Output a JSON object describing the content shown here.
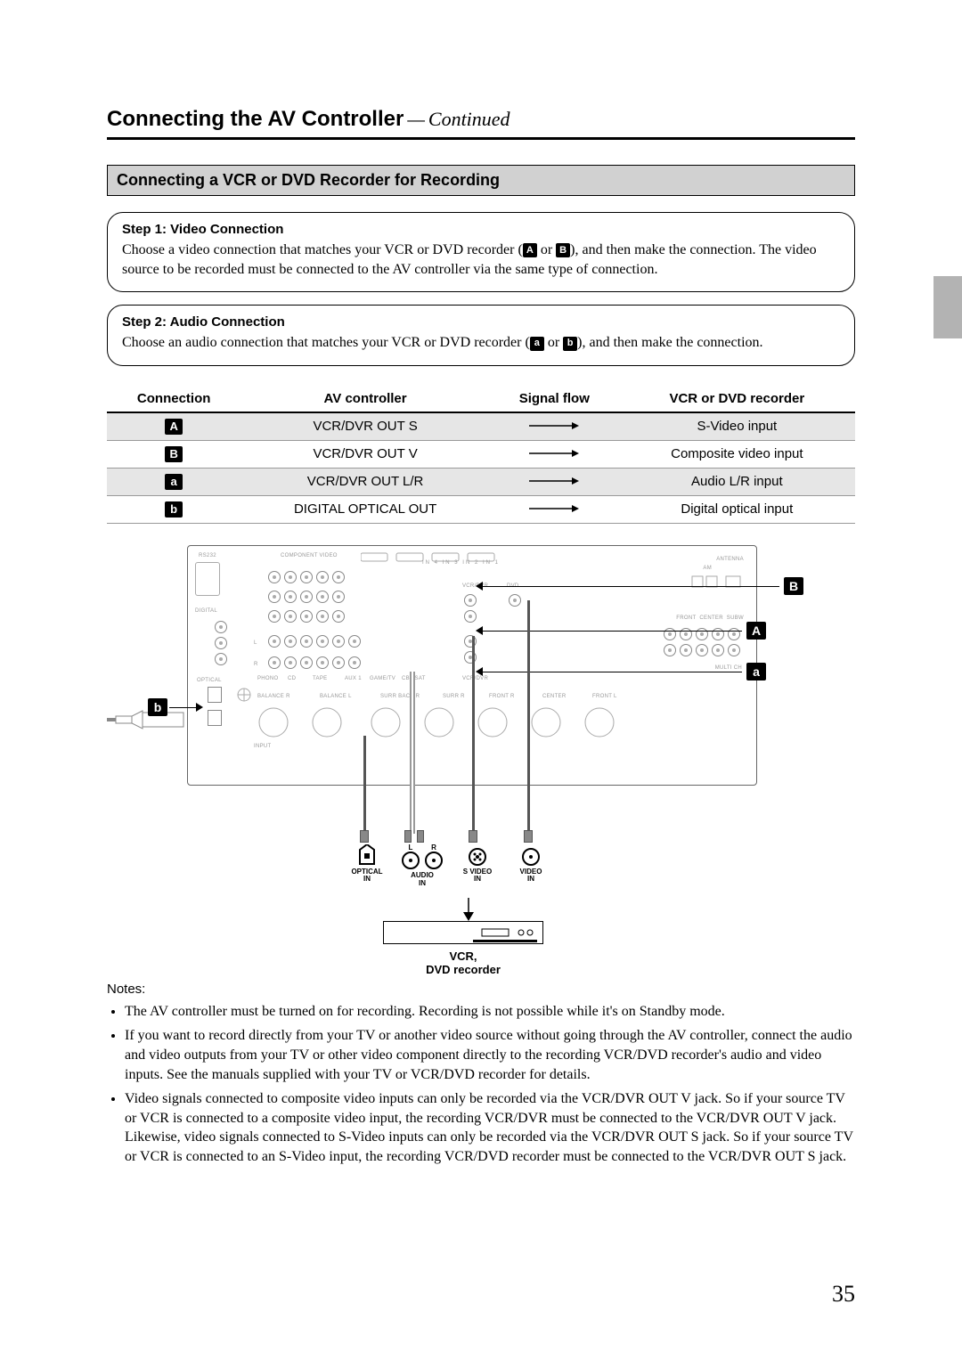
{
  "header": {
    "title_bold": "Connecting the AV Controller",
    "title_sep": "—",
    "title_italic": "Continued"
  },
  "section_bar": "Connecting a VCR or DVD Recorder for Recording",
  "step1": {
    "heading": "Step 1: Video Connection",
    "body_pre": "Choose a video connection that matches your VCR or DVD recorder (",
    "badge_a": "A",
    "mid": " or ",
    "badge_b": "B",
    "body_post": "), and then make the connection. The video source to be recorded must be connected to the AV controller via the same type of connection."
  },
  "step2": {
    "heading": "Step 2: Audio Connection",
    "body_pre": "Choose an audio connection that matches your VCR or DVD recorder (",
    "badge_a": "a",
    "mid": " or ",
    "badge_b": "b",
    "body_post": "), and then make the connection."
  },
  "table": {
    "headers": [
      "Connection",
      "AV controller",
      "Signal flow",
      "VCR or DVD recorder"
    ],
    "rows": [
      {
        "badge": "A",
        "avc": "VCR/DVR OUT S",
        "rec": "S-Video input",
        "shade": true
      },
      {
        "badge": "B",
        "avc": "VCR/DVR OUT V",
        "rec": "Composite video input",
        "shade": false
      },
      {
        "badge": "a",
        "avc": "VCR/DVR OUT L/R",
        "rec": "Audio L/R input",
        "shade": true
      },
      {
        "badge": "b",
        "avc": "DIGITAL OPTICAL OUT",
        "rec": "Digital optical input",
        "shade": false
      }
    ]
  },
  "diagram": {
    "callouts": {
      "A": "A",
      "B": "B",
      "a": "a",
      "b": "b"
    },
    "panel_tiny": {
      "rs232": "RS232",
      "digital": "DIGITAL",
      "optical": "OPTICAL",
      "component": "COMPONENT VIDEO",
      "hdmi_row": "IN 4   IN 3   IN 2   IN 1",
      "vcrdvr": "VCR/DVR",
      "dvd": "DVD",
      "antenna": "ANTENNA",
      "am": "AM",
      "front": "FRONT",
      "center": "CENTER",
      "subw": "SUBW",
      "surr": "SURR",
      "input": "INPUT",
      "balance_r": "BALANCE R",
      "balance_l": "BALANCE L",
      "surr_back_r": "SURR BACK R",
      "surr_r": "SURR R",
      "front_r": "FRONT R",
      "center2": "CENTER",
      "front_l": "FRONT L",
      "multi": "MULTI CH",
      "aux1": "AUX 1",
      "game_tv": "GAME/TV",
      "cbl_sat": "CBL/SAT",
      "tape": "TAPE",
      "cd": "CD",
      "phono": "PHONO",
      "L": "L",
      "R": "R"
    },
    "bottom_ports": {
      "optical": "OPTICAL\nIN",
      "audio": "AUDIO\nIN",
      "audio_l": "L",
      "audio_r": "R",
      "svideo": "S VIDEO\nIN",
      "video": "VIDEO\nIN"
    },
    "device_label_line1": "VCR,",
    "device_label_line2": "DVD recorder"
  },
  "notes_heading": "Notes:",
  "notes": [
    "The AV controller must be turned on for recording. Recording is not possible while it's on Standby mode.",
    "If you want to record directly from your TV or another video source without going through the AV controller, connect the audio and video outputs from your TV or other video component directly to the recording VCR/DVD recorder's audio and video inputs. See the manuals supplied with your TV or VCR/DVD recorder for details.",
    "Video signals connected to composite video inputs can only be recorded via the VCR/DVR OUT V jack. So if your source TV or VCR is connected to a composite video input, the recording VCR/DVR must be connected to the VCR/DVR OUT V jack. Likewise, video signals connected to S-Video inputs can only be recorded via the VCR/DVR OUT S jack. So if your source TV or VCR is connected to an S-Video input, the recording VCR/DVD recorder must be connected to the VCR/DVR OUT S jack."
  ],
  "page_number": "35"
}
